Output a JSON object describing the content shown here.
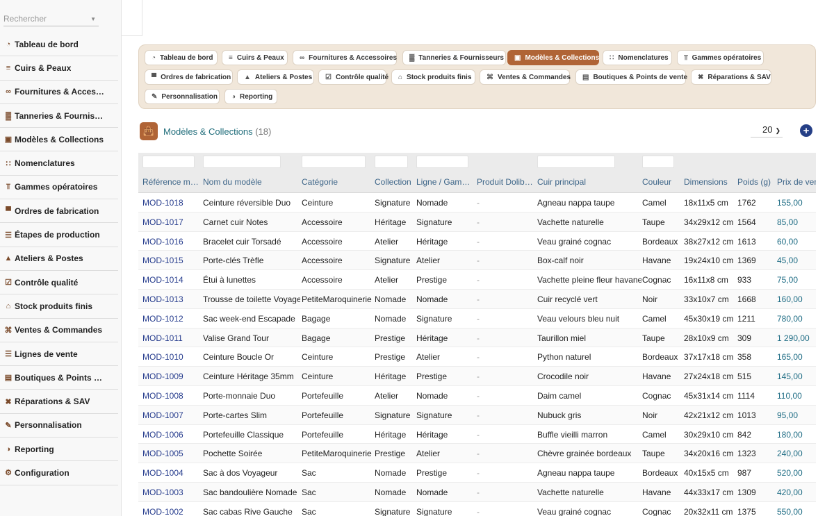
{
  "sidebar": {
    "search_placeholder": "Rechercher",
    "items": [
      {
        "label": "Tableau de bord",
        "icon": "dashboard-icon"
      },
      {
        "label": "Cuirs & Peaux",
        "icon": "layers-icon"
      },
      {
        "label": "Fournitures & Acces…",
        "icon": "link-icon"
      },
      {
        "label": "Tanneries & Fournis…",
        "icon": "factory-icon"
      },
      {
        "label": "Modèles & Collections",
        "icon": "bag-icon"
      },
      {
        "label": "Nomenclatures",
        "icon": "sitemap-icon"
      },
      {
        "label": "Gammes opératoires",
        "icon": "workflow-icon"
      },
      {
        "label": "Ordres de fabrication",
        "icon": "industry-icon"
      },
      {
        "label": "Étapes de production",
        "icon": "list-check-icon"
      },
      {
        "label": "Ateliers & Postes",
        "icon": "workshop-icon"
      },
      {
        "label": "Contrôle qualité",
        "icon": "clipboard-check-icon"
      },
      {
        "label": "Stock produits finis",
        "icon": "warehouse-icon"
      },
      {
        "label": "Ventes & Commandes",
        "icon": "cart-icon"
      },
      {
        "label": "Lignes de vente",
        "icon": "list-icon"
      },
      {
        "label": "Boutiques & Points …",
        "icon": "store-icon"
      },
      {
        "label": "Réparations & SAV",
        "icon": "tools-icon"
      },
      {
        "label": "Personnalisation",
        "icon": "brush-icon"
      },
      {
        "label": "Reporting",
        "icon": "chart-pie-icon"
      },
      {
        "label": "Configuration",
        "icon": "gear-icon"
      }
    ]
  },
  "tabs": [
    {
      "label": "Tableau de bord",
      "icon": "dashboard-icon",
      "active": false
    },
    {
      "label": "Cuirs & Peaux",
      "icon": "layers-icon",
      "active": false
    },
    {
      "label": "Fournitures & Accessoires",
      "icon": "link-icon",
      "active": false
    },
    {
      "label": "Tanneries & Fournisseurs",
      "icon": "factory-icon",
      "active": false
    },
    {
      "label": "Modèles & Collections",
      "icon": "bag-icon",
      "active": true
    },
    {
      "label": "Nomenclatures",
      "icon": "sitemap-icon",
      "active": false
    },
    {
      "label": "Gammes opératoires",
      "icon": "workflow-icon",
      "active": false
    },
    {
      "label": "Ordres de fabrication",
      "icon": "industry-icon",
      "active": false
    },
    {
      "label": "Ateliers & Postes",
      "icon": "workshop-icon",
      "active": false
    },
    {
      "label": "Contrôle qualité",
      "icon": "clipboard-check-icon",
      "active": false
    },
    {
      "label": "Stock produits finis",
      "icon": "warehouse-icon",
      "active": false
    },
    {
      "label": "Ventes & Commandes",
      "icon": "cart-icon",
      "active": false
    },
    {
      "label": "Boutiques & Points de vente",
      "icon": "store-icon",
      "active": false
    },
    {
      "label": "Réparations & SAV",
      "icon": "tools-icon",
      "active": false
    },
    {
      "label": "Personnalisation",
      "icon": "brush-icon",
      "active": false
    },
    {
      "label": "Reporting",
      "icon": "chart-pie-icon",
      "active": false
    }
  ],
  "page": {
    "title": "Modèles & Collections",
    "count": "(18)",
    "limit": "20",
    "accent_color": "#b06436",
    "link_color": "#263c8d"
  },
  "table": {
    "columns": [
      "Référence m…",
      "Nom du modèle",
      "Catégorie",
      "Collection",
      "Ligne / Gam…",
      "Produit Dolib…",
      "Cuir principal",
      "Couleur",
      "Dimensions",
      "Poids (g)",
      "Prix de vent"
    ],
    "rows": [
      [
        "MOD-1018",
        "Ceinture réversible Duo",
        "Ceinture",
        "Signature",
        "Nomade",
        "-",
        "Agneau nappa taupe",
        "Camel",
        "18x11x5 cm",
        "1762",
        "155,00"
      ],
      [
        "MOD-1017",
        "Carnet cuir Notes",
        "Accessoire",
        "Héritage",
        "Signature",
        "-",
        "Vachette naturelle",
        "Taupe",
        "34x29x12 cm",
        "1564",
        "85,00"
      ],
      [
        "MOD-1016",
        "Bracelet cuir Torsadé",
        "Accessoire",
        "Atelier",
        "Héritage",
        "-",
        "Veau grainé cognac",
        "Bordeaux",
        "38x27x12 cm",
        "1613",
        "60,00"
      ],
      [
        "MOD-1015",
        "Porte-clés Trèfle",
        "Accessoire",
        "Signature",
        "Atelier",
        "-",
        "Box-calf noir",
        "Havane",
        "19x24x10 cm",
        "1369",
        "45,00"
      ],
      [
        "MOD-1014",
        "Étui à lunettes",
        "Accessoire",
        "Atelier",
        "Prestige",
        "-",
        "Vachette pleine fleur havane",
        "Cognac",
        "16x11x8 cm",
        "933",
        "75,00"
      ],
      [
        "MOD-1013",
        "Trousse de toilette Voyage",
        "PetiteMaroquinerie",
        "Nomade",
        "Nomade",
        "-",
        "Cuir recyclé vert",
        "Noir",
        "33x10x7 cm",
        "1668",
        "160,00"
      ],
      [
        "MOD-1012",
        "Sac week-end Escapade",
        "Bagage",
        "Nomade",
        "Signature",
        "-",
        "Veau velours bleu nuit",
        "Camel",
        "45x30x19 cm",
        "1211",
        "780,00"
      ],
      [
        "MOD-1011",
        "Valise Grand Tour",
        "Bagage",
        "Prestige",
        "Héritage",
        "-",
        "Taurillon miel",
        "Taupe",
        "28x10x9 cm",
        "309",
        "1 290,00"
      ],
      [
        "MOD-1010",
        "Ceinture Boucle Or",
        "Ceinture",
        "Prestige",
        "Atelier",
        "-",
        "Python naturel",
        "Bordeaux",
        "37x17x18 cm",
        "358",
        "165,00"
      ],
      [
        "MOD-1009",
        "Ceinture Héritage 35mm",
        "Ceinture",
        "Héritage",
        "Prestige",
        "-",
        "Crocodile noir",
        "Havane",
        "27x24x18 cm",
        "515",
        "145,00"
      ],
      [
        "MOD-1008",
        "Porte-monnaie Duo",
        "Portefeuille",
        "Atelier",
        "Nomade",
        "-",
        "Daim camel",
        "Cognac",
        "45x31x14 cm",
        "1114",
        "110,00"
      ],
      [
        "MOD-1007",
        "Porte-cartes Slim",
        "Portefeuille",
        "Signature",
        "Signature",
        "-",
        "Nubuck gris",
        "Noir",
        "42x21x12 cm",
        "1013",
        "95,00"
      ],
      [
        "MOD-1006",
        "Portefeuille Classique",
        "Portefeuille",
        "Héritage",
        "Héritage",
        "-",
        "Buffle vieilli marron",
        "Camel",
        "30x29x10 cm",
        "842",
        "180,00"
      ],
      [
        "MOD-1005",
        "Pochette Soirée",
        "PetiteMaroquinerie",
        "Prestige",
        "Atelier",
        "-",
        "Chèvre grainée bordeaux",
        "Taupe",
        "34x20x16 cm",
        "1323",
        "240,00"
      ],
      [
        "MOD-1004",
        "Sac à dos Voyageur",
        "Sac",
        "Nomade",
        "Prestige",
        "-",
        "Agneau nappa taupe",
        "Bordeaux",
        "40x15x5 cm",
        "987",
        "520,00"
      ],
      [
        "MOD-1003",
        "Sac bandoulière Nomade",
        "Sac",
        "Nomade",
        "Nomade",
        "-",
        "Vachette naturelle",
        "Havane",
        "44x33x17 cm",
        "1309",
        "420,00"
      ],
      [
        "MOD-1002",
        "Sac cabas Rive Gauche",
        "Sac",
        "Signature",
        "Signature",
        "-",
        "Veau grainé cognac",
        "Cognac",
        "20x32x11 cm",
        "1375",
        "550,00"
      ]
    ]
  }
}
